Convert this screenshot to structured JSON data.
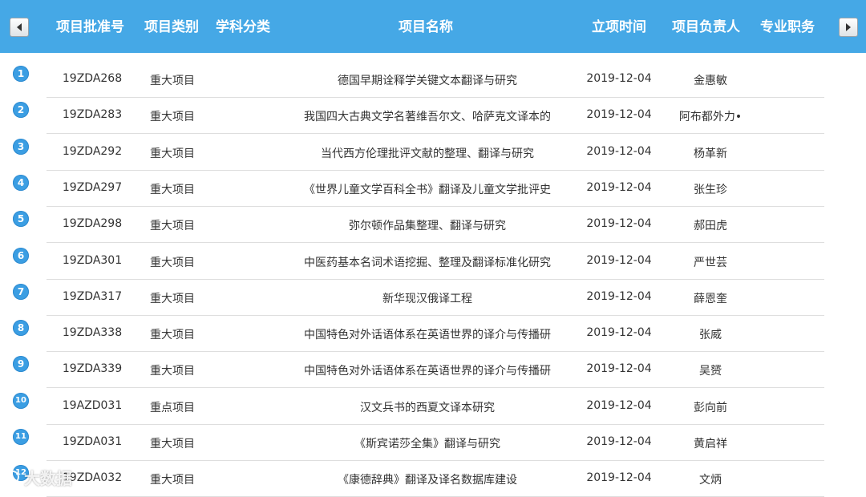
{
  "header": {
    "columns": [
      "项目批准号",
      "项目类别",
      "学科分类",
      "项目名称",
      "立项时间",
      "项目负责人",
      "专业职务"
    ]
  },
  "rows": [
    {
      "n": "1",
      "code": "19ZDA268",
      "type": "重大项目",
      "name": "德国早期诠释学关键文本翻译与研究",
      "date": "2019-12-04",
      "lead": "金惠敏"
    },
    {
      "n": "2",
      "code": "19ZDA283",
      "type": "重大项目",
      "name": "我国四大古典文学名著维吾尔文、哈萨克文译本的",
      "date": "2019-12-04",
      "lead": "阿布都外力•"
    },
    {
      "n": "3",
      "code": "19ZDA292",
      "type": "重大项目",
      "name": "当代西方伦理批评文献的整理、翻译与研究",
      "date": "2019-12-04",
      "lead": "杨革新"
    },
    {
      "n": "4",
      "code": "19ZDA297",
      "type": "重大项目",
      "name": "《世界儿童文学百科全书》翻译及儿童文学批评史",
      "date": "2019-12-04",
      "lead": "张生珍"
    },
    {
      "n": "5",
      "code": "19ZDA298",
      "type": "重大项目",
      "name": "弥尔顿作品集整理、翻译与研究",
      "date": "2019-12-04",
      "lead": "郝田虎"
    },
    {
      "n": "6",
      "code": "19ZDA301",
      "type": "重大项目",
      "name": "中医药基本名词术语挖掘、整理及翻译标准化研究",
      "date": "2019-12-04",
      "lead": "严世芸"
    },
    {
      "n": "7",
      "code": "19ZDA317",
      "type": "重大项目",
      "name": "新华现汉俄译工程",
      "date": "2019-12-04",
      "lead": "薛恩奎"
    },
    {
      "n": "8",
      "code": "19ZDA338",
      "type": "重大项目",
      "name": "中国特色对外话语体系在英语世界的译介与传播研",
      "date": "2019-12-04",
      "lead": "张威"
    },
    {
      "n": "9",
      "code": "19ZDA339",
      "type": "重大项目",
      "name": "中国特色对外话语体系在英语世界的译介与传播研",
      "date": "2019-12-04",
      "lead": "吴赟"
    },
    {
      "n": "10",
      "code": "19AZD031",
      "type": "重点项目",
      "name": "汉文兵书的西夏文译本研究",
      "date": "2019-12-04",
      "lead": "彭向前"
    },
    {
      "n": "11",
      "code": "19ZDA031",
      "type": "重大项目",
      "name": "《斯宾诺莎全集》翻译与研究",
      "date": "2019-12-04",
      "lead": "黄启祥"
    },
    {
      "n": "12",
      "code": "19ZDA032",
      "type": "重大项目",
      "name": "《康德辞典》翻译及译名数据库建设",
      "date": "2019-12-04",
      "lead": "文炳"
    }
  ],
  "watermark": {
    "text": "大数据"
  },
  "colors": {
    "header_bg": "#45a8e6",
    "badge": "#3b9ee3",
    "row_line": "#dedede"
  },
  "icons": {
    "prev": "left-arrow-icon",
    "next": "right-arrow-icon"
  }
}
